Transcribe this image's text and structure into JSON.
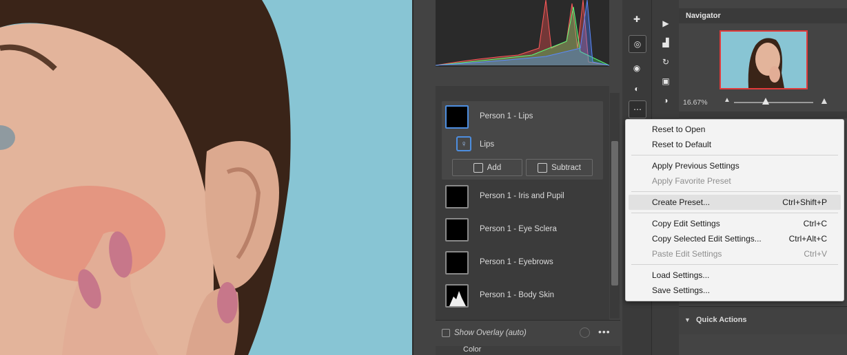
{
  "mask_panel": {
    "masks": [
      {
        "label": "Person 1 - Lips",
        "selected": true
      },
      {
        "label": "Person 1 - Iris and Pupil"
      },
      {
        "label": "Person 1 - Eye Sclera"
      },
      {
        "label": "Person 1 - Eyebrows"
      },
      {
        "label": "Person 1 - Body Skin"
      }
    ],
    "component_label": "Lips",
    "add_label": "Add",
    "subtract_label": "Subtract",
    "show_overlay_label": "Show Overlay (auto)",
    "color_section_label": "Color"
  },
  "navigator": {
    "title": "Navigator",
    "zoom": "16.67%",
    "quick_actions_label": "Quick Actions"
  },
  "context_menu": {
    "items": [
      {
        "label": "Reset to Open",
        "shortcut": "",
        "disabled": false
      },
      {
        "label": "Reset to Default",
        "shortcut": "",
        "disabled": false
      },
      {
        "label": "Apply Previous Settings",
        "shortcut": "",
        "disabled": false
      },
      {
        "label": "Apply Favorite Preset",
        "shortcut": "",
        "disabled": true
      },
      {
        "label": "Create Preset...",
        "shortcut": "Ctrl+Shift+P",
        "disabled": false,
        "highlighted": true
      },
      {
        "label": "Copy Edit Settings",
        "shortcut": "Ctrl+C",
        "disabled": false
      },
      {
        "label": "Copy Selected Edit Settings...",
        "shortcut": "Ctrl+Alt+C",
        "disabled": false
      },
      {
        "label": "Paste Edit Settings",
        "shortcut": "Ctrl+V",
        "disabled": true
      },
      {
        "label": "Load Settings...",
        "shortcut": "",
        "disabled": false
      },
      {
        "label": "Save Settings...",
        "shortcut": "",
        "disabled": false
      }
    ]
  },
  "icons": {
    "tools": [
      "healing-brush-icon",
      "masking-icon",
      "red-eye-icon",
      "presets-icon",
      "more-options-icon"
    ],
    "side": [
      "play-icon",
      "histogram-icon",
      "history-icon",
      "snapshot-icon",
      "adjustment-icon"
    ]
  },
  "colors": {
    "panel_bg": "#434343",
    "accent_blue": "#4d8ee0",
    "menu_bg": "#f3f3f3",
    "highlight_row": "#e1e1e1",
    "navigator_border": "#e33a3a"
  }
}
